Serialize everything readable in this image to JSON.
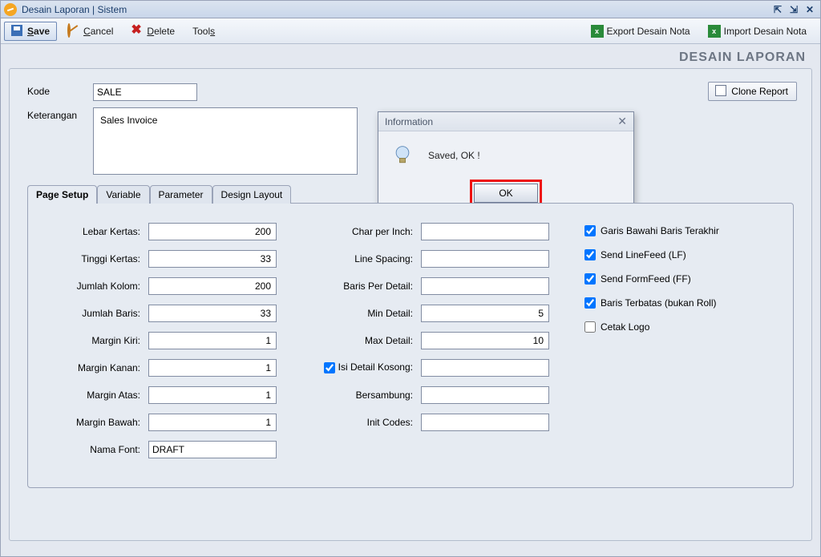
{
  "window": {
    "title": "Desain Laporan | Sistem"
  },
  "toolbar": {
    "save": "Save",
    "cancel": "Cancel",
    "delete": "Delete",
    "tools": "Tools",
    "export": "Export Desain Nota",
    "import": "Import Desain Nota"
  },
  "heading": "DESAIN LAPORAN",
  "clone": "Clone Report",
  "form": {
    "kode_label": "Kode",
    "kode_value": "SALE",
    "ket_label": "Keterangan",
    "ket_value": "Sales Invoice"
  },
  "tabs": {
    "page_setup": "Page Setup",
    "variable": "Variable",
    "parameter": "Parameter",
    "design_layout": "Design Layout"
  },
  "page_setup": {
    "lebar_kertas": {
      "label": "Lebar Kertas:",
      "value": "200"
    },
    "tinggi_kertas": {
      "label": "Tinggi Kertas:",
      "value": "33"
    },
    "jumlah_kolom": {
      "label": "Jumlah Kolom:",
      "value": "200"
    },
    "jumlah_baris": {
      "label": "Jumlah Baris:",
      "value": "33"
    },
    "margin_kiri": {
      "label": "Margin Kiri:",
      "value": "1"
    },
    "margin_kanan": {
      "label": "Margin Kanan:",
      "value": "1"
    },
    "margin_atas": {
      "label": "Margin Atas:",
      "value": "1"
    },
    "margin_bawah": {
      "label": "Margin Bawah:",
      "value": "1"
    },
    "nama_font": {
      "label": "Nama Font:",
      "value": "DRAFT"
    },
    "char_per_inch": {
      "label": "Char per Inch:",
      "value": ""
    },
    "line_spacing": {
      "label": "Line Spacing:",
      "value": ""
    },
    "baris_per_detail": {
      "label": "Baris Per Detail:",
      "value": ""
    },
    "min_detail": {
      "label": "Min Detail:",
      "value": "5"
    },
    "max_detail": {
      "label": "Max Detail:",
      "value": "10"
    },
    "isi_detail_kosong": {
      "label": "Isi Detail Kosong:",
      "value": ""
    },
    "bersambung": {
      "label": "Bersambung:",
      "value": ""
    },
    "init_codes": {
      "label": "Init Codes:",
      "value": ""
    }
  },
  "checkboxes": {
    "garis_bawahi": {
      "label": "Garis Bawahi Baris Terakhir",
      "checked": true
    },
    "send_lf": {
      "label": "Send LineFeed (LF)",
      "checked": true
    },
    "send_ff": {
      "label": "Send FormFeed (FF)",
      "checked": true
    },
    "baris_terbatas": {
      "label": "Baris Terbatas (bukan Roll)",
      "checked": true
    },
    "cetak_logo": {
      "label": "Cetak Logo",
      "checked": false
    }
  },
  "dialog": {
    "title": "Information",
    "message": "Saved, OK !",
    "ok": "OK"
  }
}
